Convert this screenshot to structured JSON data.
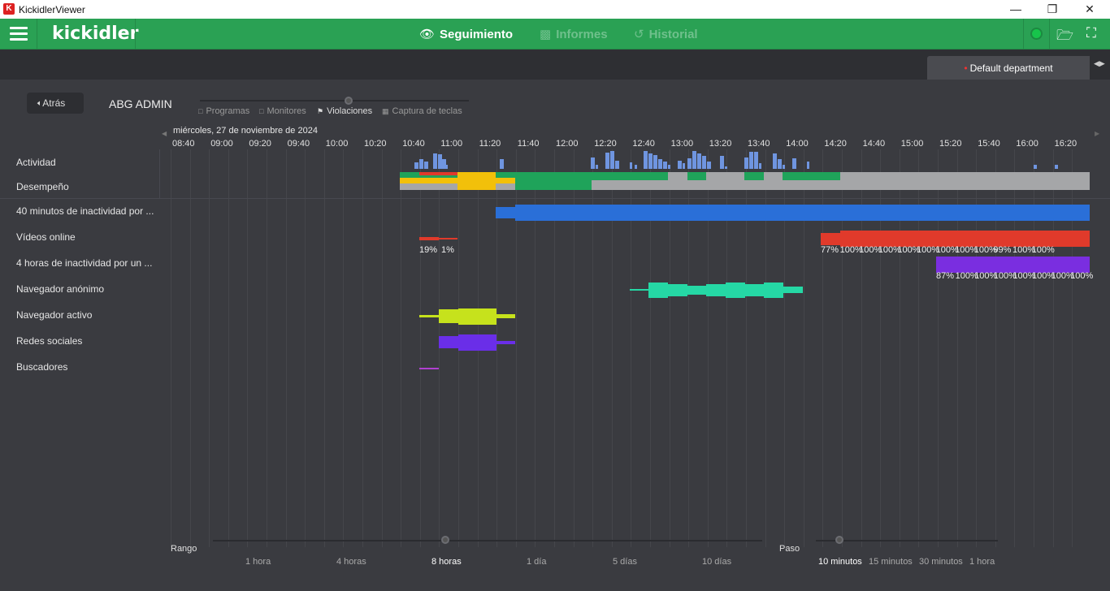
{
  "window": {
    "title": "KickidlerViewer"
  },
  "topbar": {
    "logo": "kickidler",
    "nav": [
      {
        "label": "Seguimiento",
        "icon": "eye-icon",
        "active": true
      },
      {
        "label": "Informes",
        "icon": "document-icon",
        "active": false
      },
      {
        "label": "Historial",
        "icon": "history-icon",
        "active": false
      }
    ],
    "status_color": "#17c44b"
  },
  "department": {
    "label": "Default department"
  },
  "header": {
    "back_label": "Atrás",
    "user": "ABG ADMIN",
    "modes": [
      "Programas",
      "Monitores",
      "Violaciones",
      "Captura de teclas"
    ],
    "active_mode": "Violaciones"
  },
  "timeline": {
    "date": "miércoles, 27 de noviembre de 2024",
    "times": [
      "08:40",
      "09:00",
      "09:20",
      "09:40",
      "10:00",
      "10:20",
      "10:40",
      "11:00",
      "11:20",
      "11:40",
      "12:00",
      "12:20",
      "12:40",
      "13:00",
      "13:20",
      "13:40",
      "14:00",
      "14:20",
      "14:40",
      "15:00",
      "15:20",
      "15:40",
      "16:00",
      "16:20"
    ]
  },
  "rows": [
    {
      "label": "Actividad"
    },
    {
      "label": "Desempeño"
    },
    {
      "label": "40 minutos de inactividad por ..."
    },
    {
      "label": "Vídeos online"
    },
    {
      "label": "4 horas de inactividad por un ..."
    },
    {
      "label": "Navegador anónimo"
    },
    {
      "label": "Navegador activo"
    },
    {
      "label": "Redes sociales"
    },
    {
      "label": "Buscadores"
    }
  ],
  "video_pcts_early": [
    "19%",
    "1%"
  ],
  "video_pcts_late": [
    "77%",
    "100%",
    "100%",
    "100%",
    "100%",
    "100%",
    "100%",
    "100%",
    "100%",
    "99%",
    "100%",
    "100%"
  ],
  "inactivity_pcts": [
    "87%",
    "100%",
    "100%",
    "100%",
    "100%",
    "100%",
    "100%",
    "100%"
  ],
  "colors": {
    "activity": "#6f95e0",
    "productive": "#1fa35a",
    "neutral": "#a5a6a8",
    "warning": "#f2c00a",
    "violation_red": "#e03a2b",
    "inactivity_blue": "#2a6fd8",
    "inactivity_purple": "#7a2ee0",
    "anon_browser": "#25d8a5",
    "active_browser": "#c6e21c",
    "social": "#6a2ee8",
    "search": "#b040d0"
  },
  "range": {
    "title": "Rango",
    "options": [
      "1 hora",
      "4 horas",
      "8 horas",
      "1 día",
      "5 días",
      "10 días"
    ],
    "selected": "8 horas"
  },
  "step": {
    "title": "Paso",
    "options": [
      "10 minutos",
      "15 minutos",
      "30 minutos",
      "1 hora"
    ],
    "selected": "10 minutos"
  }
}
